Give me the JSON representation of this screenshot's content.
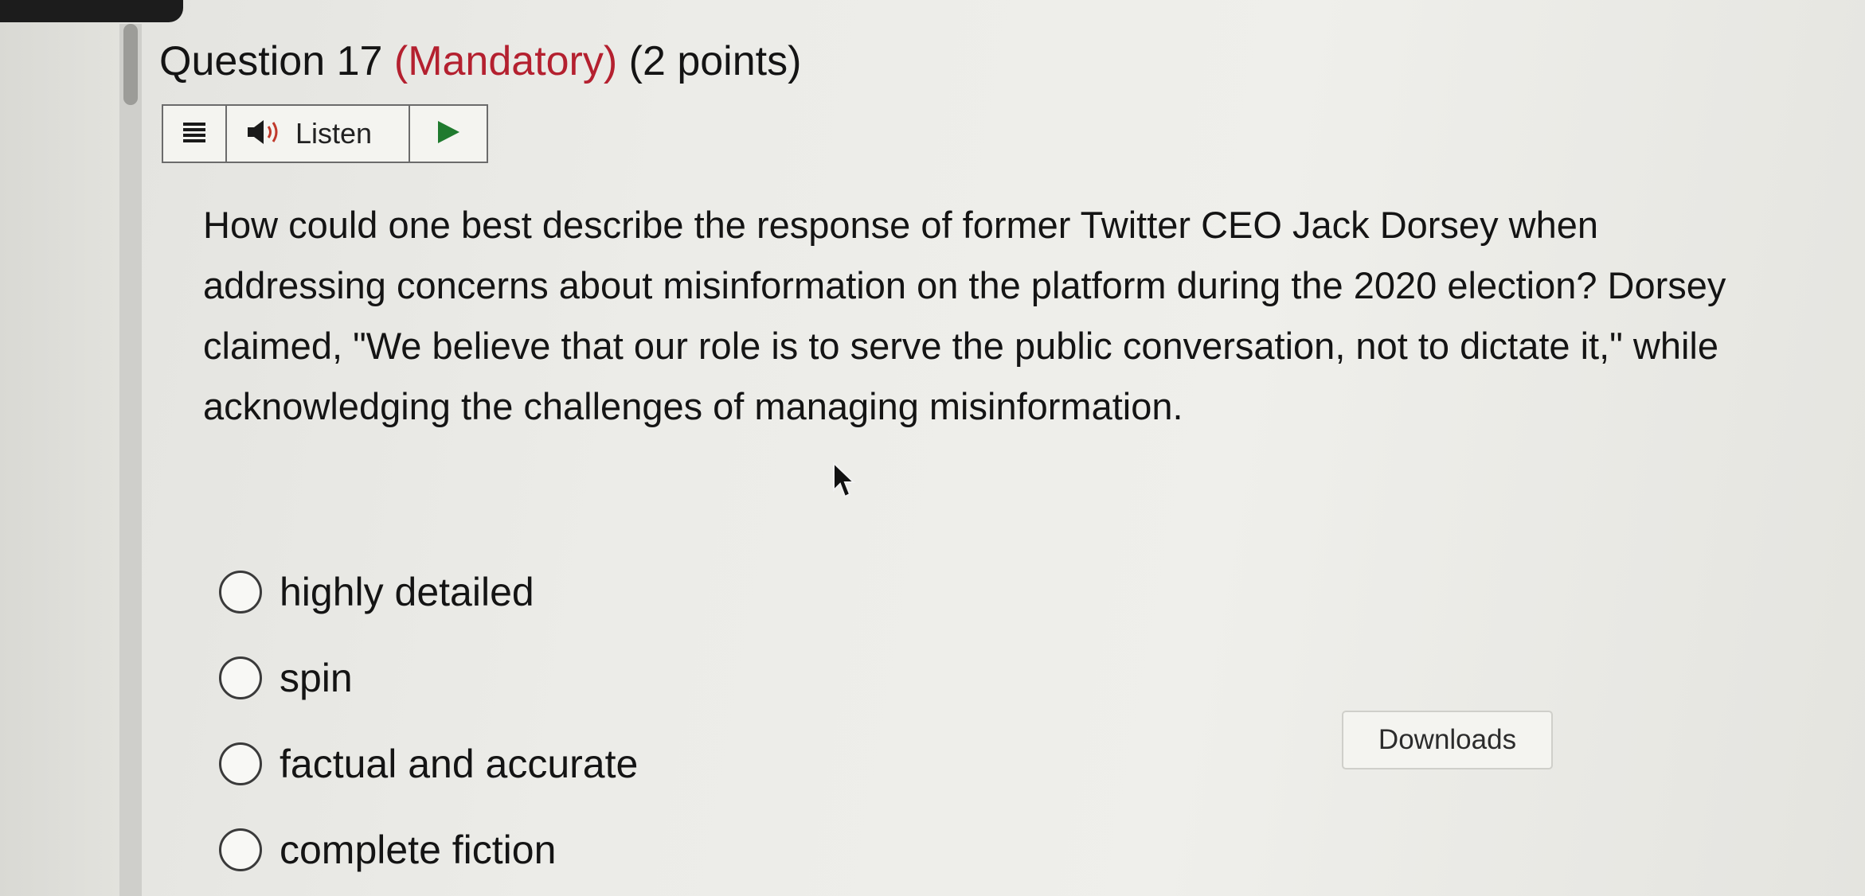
{
  "question": {
    "title_prefix": "Question 17 ",
    "title_mandatory": "(Mandatory)",
    "title_points": " (2 points)",
    "body": "How could one best describe the response of former Twitter CEO Jack Dorsey when addressing concerns about misinformation on the platform during the 2020 election? Dorsey claimed, \"We believe that our role is to serve the public conversation, not to dictate it,\" while acknowledging the challenges of managing misinformation.",
    "options": [
      {
        "label": "highly detailed",
        "selected": false
      },
      {
        "label": "spin",
        "selected": false
      },
      {
        "label": "factual and accurate",
        "selected": false
      },
      {
        "label": "complete fiction",
        "selected": false
      }
    ]
  },
  "toolbar": {
    "listen_label": "Listen",
    "menu_icon": "hamburger-menu-icon",
    "speaker_icon": "speaker-icon",
    "play_icon": "play-icon"
  },
  "downloads": {
    "label": "Downloads"
  },
  "colors": {
    "mandatory": "#b4202f",
    "play_accent": "#1f7a2e"
  }
}
